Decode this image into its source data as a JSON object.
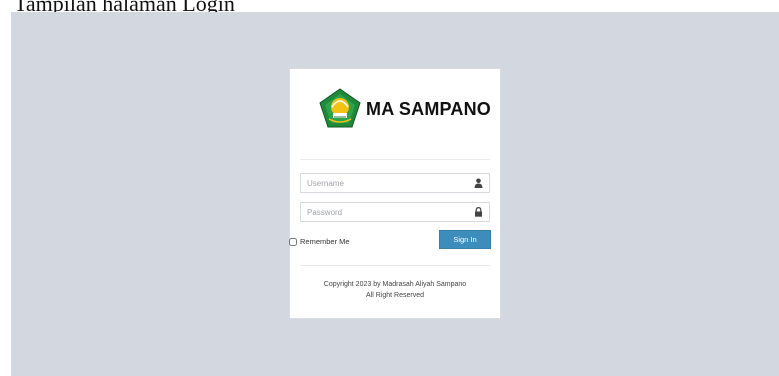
{
  "caption": "Tampilan halaman Login",
  "brand": {
    "name": "MA SAMPANO",
    "logo_icon": "kemenag-logo"
  },
  "form": {
    "username_placeholder": "Username",
    "username_icon": "user-icon",
    "password_placeholder": "Password",
    "password_icon": "lock-icon",
    "remember_label": "Remember Me",
    "remember_checked": false,
    "signin_label": "Sign In"
  },
  "footer": {
    "line1": "Copyright 2023 by Madrasah Aliyah Sampano",
    "line2": "All Right Reserved"
  },
  "colors": {
    "background": "#d3d7df",
    "button": "#3c8dbc",
    "logo_green": "#1f8a3a",
    "logo_yellow": "#f2c314"
  }
}
